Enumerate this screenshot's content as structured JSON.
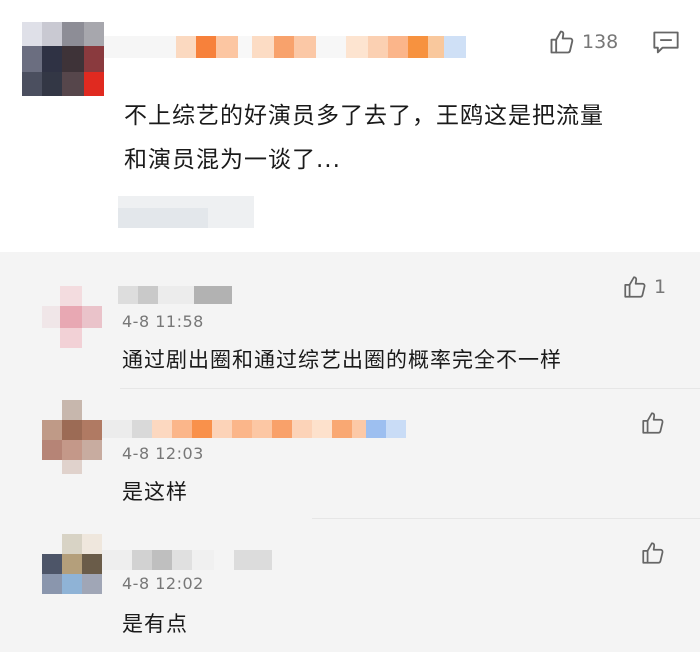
{
  "main_comment": {
    "text_line1": "不上综艺的好演员多了去了，王鸥这是把流量",
    "text_line2": "和演员混为一谈了...",
    "like_count": "138"
  },
  "replies": [
    {
      "time": "4-8 11:58",
      "text": "通过剧出圈和通过综艺出圈的概率完全不一样",
      "like_count": "1"
    },
    {
      "time": "4-8 12:03",
      "text": "是这样",
      "like_count": ""
    },
    {
      "time": "4-8 12:02",
      "text": "是有点",
      "like_count": ""
    }
  ],
  "icons": {
    "like": "thumbs-up-icon",
    "comment": "comment-icon"
  },
  "colors": {
    "reply_background": "#f4f4f4",
    "pixelated_name_orange": "#f6a466",
    "pixelated_name_blue": "#a9c9f2"
  }
}
